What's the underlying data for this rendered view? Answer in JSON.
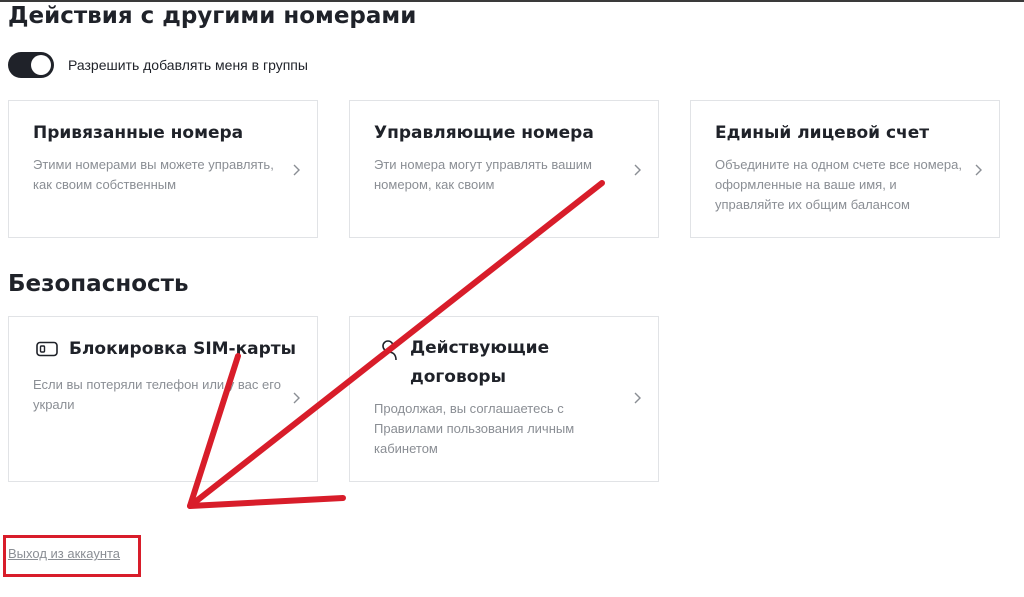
{
  "sections": {
    "actions_title": "Действия с другими номерами",
    "security_title": "Безопасность"
  },
  "toggle": {
    "label": "Разрешить добавлять меня в группы",
    "state": "on"
  },
  "cards": {
    "linked": {
      "title": "Привязанные номера",
      "description": "Этими номерами вы можете управлять, как своим собственным"
    },
    "managing": {
      "title": "Управляющие номера",
      "description": "Эти номера могут управлять вашим номером, как своим"
    },
    "single_account": {
      "title": "Единый лицевой счет",
      "description": "Объедините на одном счете все номера, оформленные на ваше имя, и управляйте их общим балансом"
    },
    "sim_block": {
      "title": "Блокировка SIM-карты",
      "description": "Если вы потеряли телефон или у вас его украли",
      "icon": "sim-card-icon"
    },
    "contracts": {
      "title": "Действующие договоры",
      "description": "Продолжая, вы соглашаетесь с Правилами пользования личным кабинетом",
      "icon": "person-icon"
    }
  },
  "logout": {
    "label": "Выход из аккаунта"
  },
  "colors": {
    "text": "#1f2229",
    "muted": "#8a8e94",
    "border": "#e1e3e6",
    "annotation": "#d81d2a"
  }
}
